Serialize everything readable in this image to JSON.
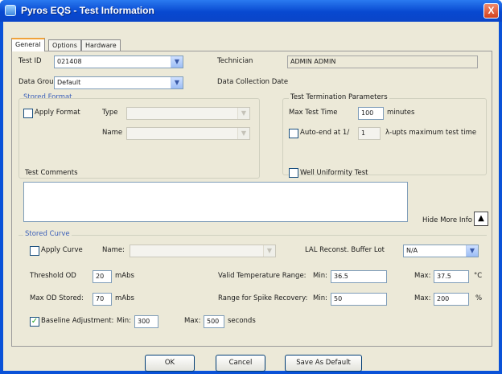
{
  "window": {
    "title": "Pyros EQS - Test Information",
    "close_label": "X"
  },
  "tabs": [
    "General",
    "Options",
    "Hardware"
  ],
  "general": {
    "test_id_label": "Test ID",
    "test_id_value": "021408",
    "technician_label": "Technician",
    "technician_value": "ADMIN ADMIN",
    "data_group_label": "Data Group",
    "data_group_value": "Default",
    "data_collection_date_label": "Data Collection Date"
  },
  "stored_format": {
    "group_label": "Stored Format",
    "apply_label": "Apply Format",
    "apply_checked": false,
    "type_label": "Type",
    "name_label": "Name"
  },
  "termination": {
    "group_label": "Test Termination Parameters",
    "max_time_label": "Max Test Time",
    "max_time_value": "100",
    "max_time_unit": "minutes",
    "auto_end_label": "Auto-end at 1/",
    "auto_end_checked": false,
    "auto_end_value": "1",
    "auto_end_suffix": "λ-upts maximum test time"
  },
  "comments": {
    "label": "Test Comments",
    "well_uniformity_label": "Well Uniformity Test",
    "well_uniformity_checked": false,
    "hide_more_label": "Hide More Info",
    "arrow_icon": "arrow-up-icon"
  },
  "stored_curve": {
    "group_label": "Stored Curve",
    "apply_label": "Apply Curve",
    "apply_checked": false,
    "name_label": "Name:",
    "lal_label": "LAL Reconst. Buffer Lot",
    "lal_value": "N/A"
  },
  "parameters": {
    "threshold_label": "Threshold OD",
    "threshold_value": "20",
    "threshold_unit": "mAbs",
    "valid_temp_label": "Valid Temperature Range:",
    "temp_min_label": "Min:",
    "temp_min_value": "36.5",
    "temp_max_label": "Max:",
    "temp_max_value": "37.5",
    "temp_unit": "°C",
    "max_od_label": "Max OD Stored:",
    "max_od_value": "70",
    "max_od_unit": "mAbs",
    "spike_label": "Range for Spike Recovery:",
    "spike_min_label": "Min:",
    "spike_min_value": "50",
    "spike_max_label": "Max:",
    "spike_max_value": "200",
    "spike_unit": "%",
    "baseline_label": "Baseline Adjustment:",
    "baseline_checked": true,
    "baseline_min_label": "Min:",
    "baseline_min_value": "300",
    "baseline_max_label": "Max:",
    "baseline_max_value": "500",
    "baseline_unit": "seconds"
  },
  "buttons": {
    "ok": "OK",
    "cancel": "Cancel",
    "save_default": "Save As Default"
  }
}
